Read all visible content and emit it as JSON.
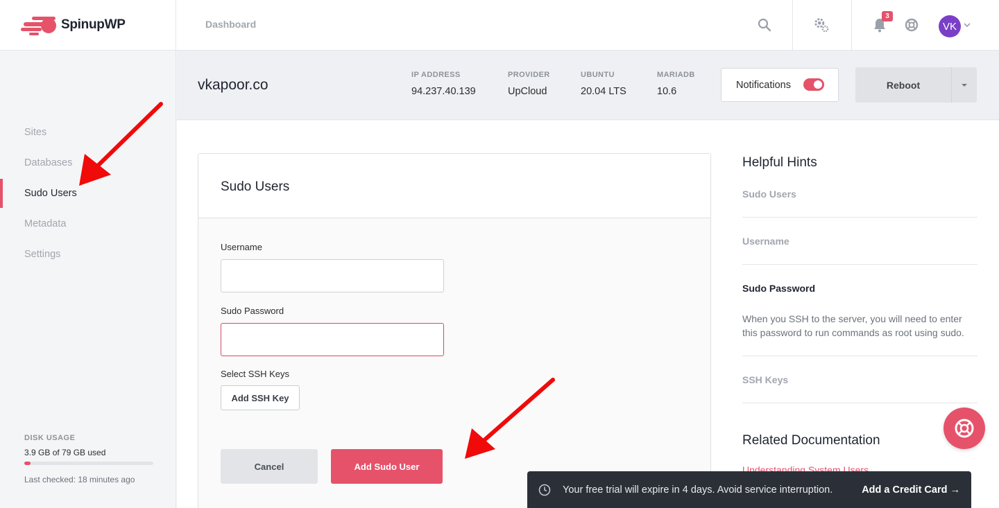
{
  "header": {
    "app_name": "SpinupWP",
    "breadcrumb": "Dashboard",
    "notification_count": "3",
    "avatar_initials": "VK",
    "icons": [
      "search-icon",
      "gear-icon",
      "bell-icon",
      "help-icon",
      "chevron-down-icon"
    ]
  },
  "sidebar": {
    "items": [
      {
        "label": "Sites"
      },
      {
        "label": "Databases"
      },
      {
        "label": "Sudo Users"
      },
      {
        "label": "Metadata"
      },
      {
        "label": "Settings"
      }
    ],
    "active_item": "Sudo Users",
    "disk": {
      "label": "DISK USAGE",
      "used_text": "3.9 GB of 79 GB used",
      "fraction_used": 0.049,
      "last_checked": "Last checked: 18 minutes ago"
    }
  },
  "server": {
    "name": "vkapoor.co",
    "meta": [
      {
        "label": "IP ADDRESS",
        "value": "94.237.40.139"
      },
      {
        "label": "PROVIDER",
        "value": "UpCloud"
      },
      {
        "label": "UBUNTU",
        "value": "20.04 LTS"
      },
      {
        "label": "MARIADB",
        "value": "10.6"
      }
    ],
    "notifications_label": "Notifications",
    "notifications_on": true,
    "reboot_label": "Reboot"
  },
  "form": {
    "title": "Sudo Users",
    "username_label": "Username",
    "username_value": "",
    "password_label": "Sudo Password",
    "password_value": "",
    "ssh_label": "Select SSH Keys",
    "add_ssh_key": "Add SSH Key",
    "cancel": "Cancel",
    "submit": "Add Sudo User"
  },
  "hints": {
    "title": "Helpful Hints",
    "items": [
      {
        "label": "Sudo Users"
      },
      {
        "label": "Username"
      },
      {
        "label": "Sudo Password"
      },
      {
        "label": "SSH Keys"
      }
    ],
    "active_description": "When you SSH to the server, you will need to enter this password to run commands as root using sudo.",
    "docs_title": "Related Documentation",
    "docs_link": "Understanding System Users"
  },
  "toast": {
    "message": "Your free trial will expire in 4 days. Avoid service interruption.",
    "action": "Add a Credit Card →"
  },
  "colors": {
    "accent": "#e5526a",
    "avatar": "#7b3fc7",
    "toast_bg": "#2b3038",
    "annotation_arrow": "#f00a0a"
  }
}
